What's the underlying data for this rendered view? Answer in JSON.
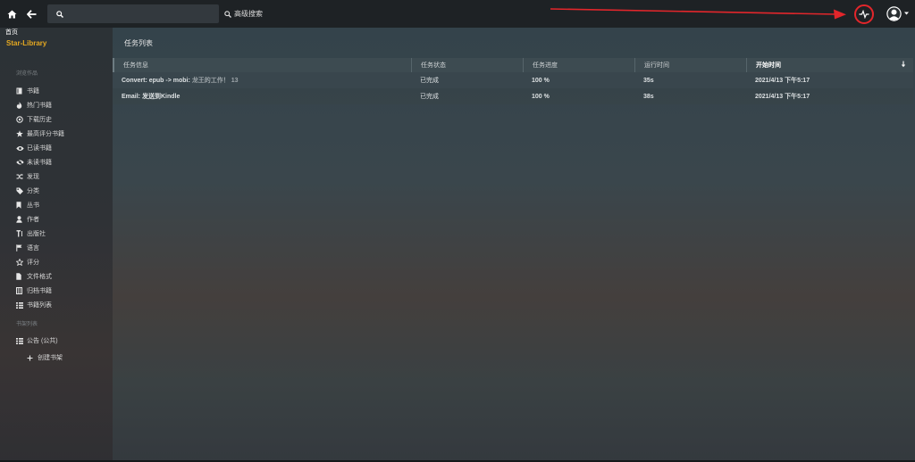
{
  "topbar": {
    "search_placeholder": "",
    "advanced_search_label": "高级搜索",
    "home_tooltip": "首页"
  },
  "sidebar": {
    "brand": "Star-Library",
    "browse_section_label": "浏览作品",
    "browse_items": [
      {
        "icon": "book-icon",
        "label": "书籍"
      },
      {
        "icon": "fire-icon",
        "label": "热门书籍"
      },
      {
        "icon": "download-history-icon",
        "label": "下载历史"
      },
      {
        "icon": "star-icon",
        "label": "最高评分书籍"
      },
      {
        "icon": "eye-icon",
        "label": "已读书籍"
      },
      {
        "icon": "eye-slash-icon",
        "label": "未读书籍"
      },
      {
        "icon": "shuffle-icon",
        "label": "发现"
      },
      {
        "icon": "tags-icon",
        "label": "分类"
      },
      {
        "icon": "bookmark-icon",
        "label": "丛书"
      },
      {
        "icon": "user-icon",
        "label": "作者"
      },
      {
        "icon": "text-height-icon",
        "label": "出版社"
      },
      {
        "icon": "flag-icon",
        "label": "语言"
      },
      {
        "icon": "star-outline-icon",
        "label": "评分"
      },
      {
        "icon": "file-icon",
        "label": "文件格式"
      },
      {
        "icon": "archive-icon",
        "label": "归档书籍"
      },
      {
        "icon": "list-icon",
        "label": "书籍列表"
      }
    ],
    "shelves_section_label": "书架列表",
    "shelves": [
      {
        "icon": "list-icon",
        "label": "公告 (公共)"
      }
    ],
    "create_shelf_label": "创建书架"
  },
  "main": {
    "title": "任务列表",
    "columns": [
      "任务信息",
      "任务状态",
      "任务进度",
      "运行时间",
      "开始时间"
    ],
    "rows": [
      {
        "info_prefix": "Convert: epub -> mobi:",
        "info_detail": "龙王的工作！ 13",
        "status": "已完成",
        "progress": "100 %",
        "runtime": "35s",
        "start": "2021/4/13 下午5:17"
      },
      {
        "info_prefix": "Email: 发送到Kindle",
        "info_detail": "",
        "status": "已完成",
        "progress": "100 %",
        "runtime": "38s",
        "start": "2021/4/13 下午5:17"
      }
    ]
  },
  "colors": {
    "brand": "#e6a921",
    "highlight_ring": "#e3262b",
    "topbar": "#1e2225"
  }
}
